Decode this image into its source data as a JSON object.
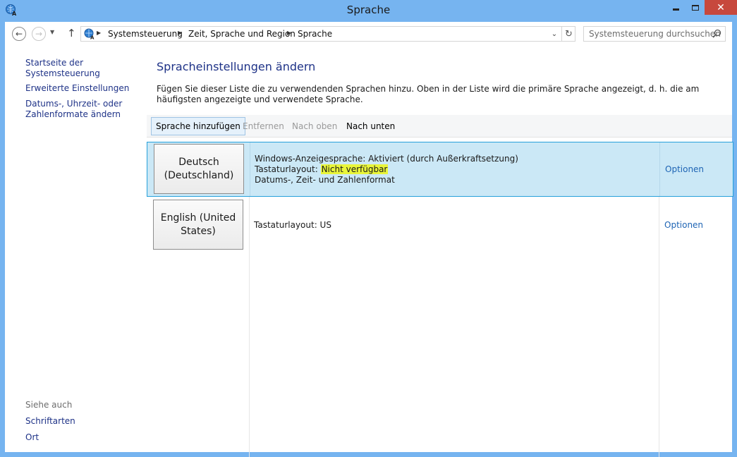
{
  "window": {
    "title": "Sprache"
  },
  "nav": {
    "breadcrumbs": [
      "Systemsteuerung",
      "Zeit, Sprache und Region",
      "Sprache"
    ],
    "search_placeholder": "Systemsteuerung durchsuchen"
  },
  "left_pane": {
    "control_panel_home": "Startseite der Systemsteuerung",
    "advanced_settings": "Erweiterte Einstellungen",
    "date_formats": "Datums-, Uhrzeit- oder Zahlenformate ändern",
    "see_also": "Siehe auch",
    "fonts": "Schriftarten",
    "location": "Ort"
  },
  "main": {
    "title": "Spracheinstellungen ändern",
    "description": "Fügen Sie dieser Liste die zu verwendenden Sprachen hinzu. Oben in der Liste wird die primäre Sprache angezeigt, d. h. die am häufigsten angezeigte und verwendete Sprache."
  },
  "toolbar": {
    "add_label": "Sprache hinzufügen",
    "remove_label": "Entfernen",
    "move_up_label": "Nach oben",
    "move_down_label": "Nach unten"
  },
  "languages": [
    {
      "name_line1": "Deutsch",
      "name_line2": "(Deutschland)",
      "display_language": "Windows-Anzeigesprache: Aktiviert (durch Außerkraftsetzung)",
      "keyboard_prefix": "Tastaturlayout: ",
      "keyboard_value": "Nicht verfügbar",
      "format": "Datums-, Zeit- und Zahlenformat",
      "options_label": "Optionen",
      "selected": true
    },
    {
      "name_line1": "English (United",
      "name_line2": "States)",
      "keyboard": "Tastaturlayout: US",
      "options_label": "Optionen",
      "selected": false
    }
  ],
  "colors": {
    "title_bar": "#76b4f0",
    "close_button": "#c7483d",
    "link": "#1e3287",
    "selection_bg": "#cbe8f6",
    "selection_border": "#26a0da",
    "highlight": "#e9f53a"
  }
}
